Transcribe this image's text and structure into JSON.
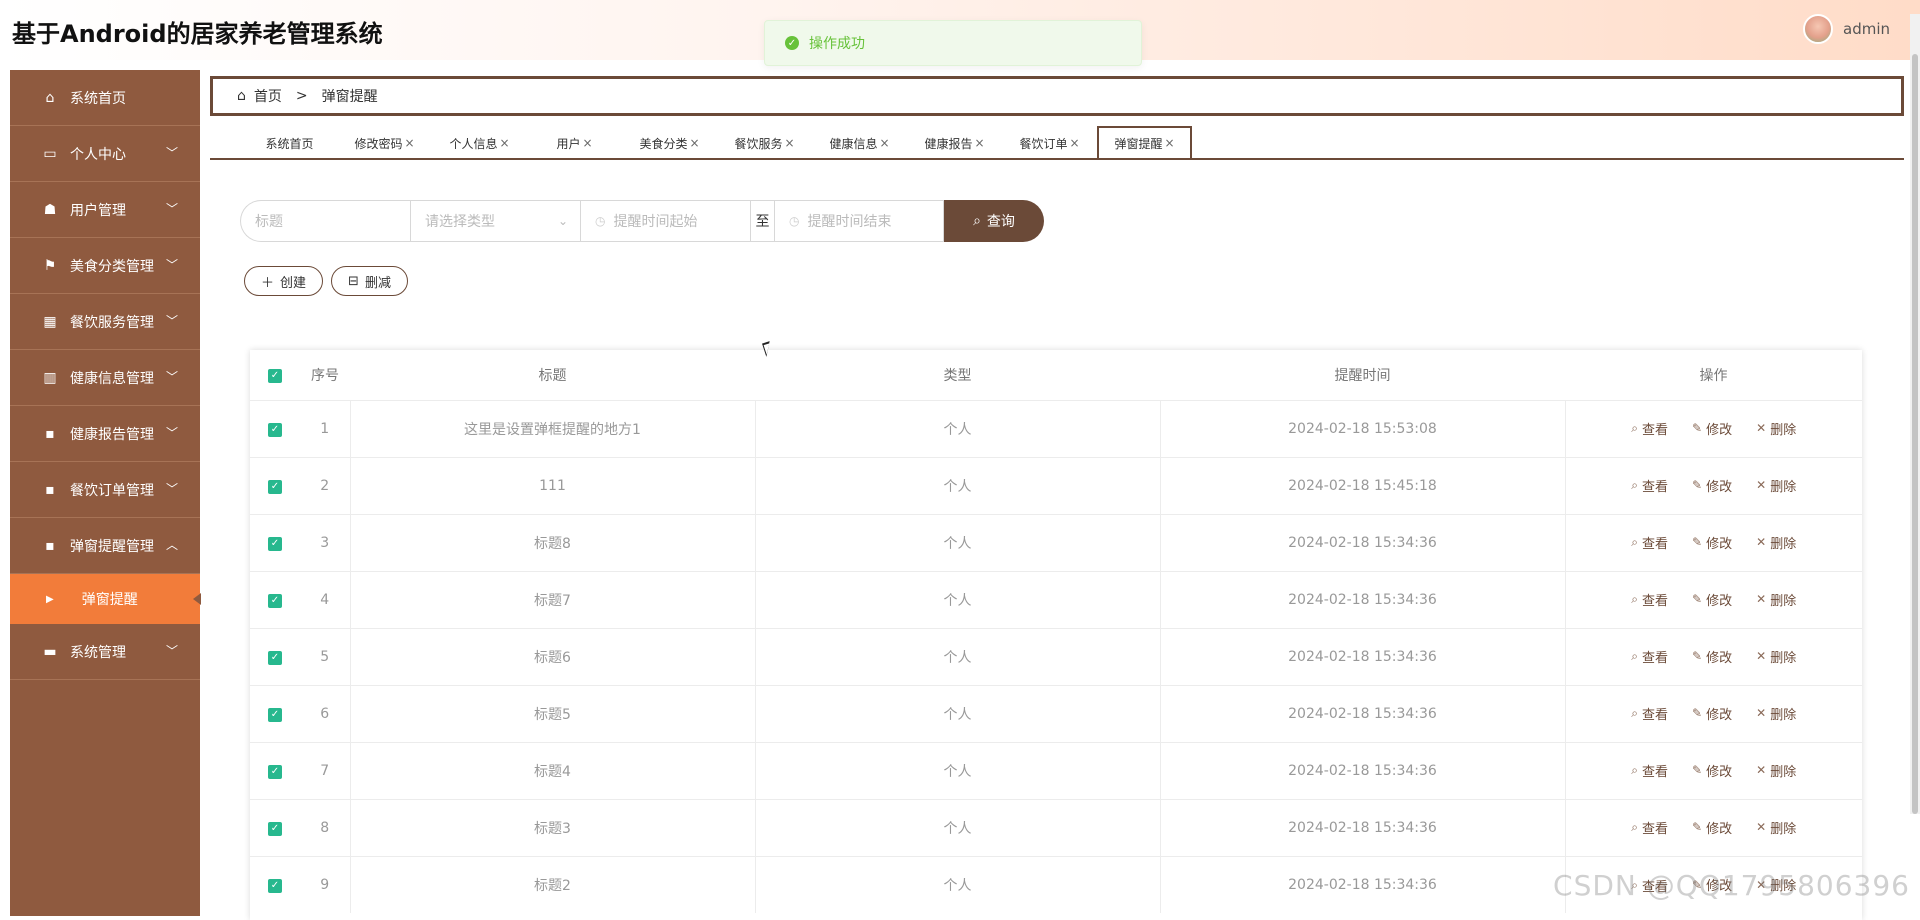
{
  "app": {
    "title": "基于Android的居家养老管理系统"
  },
  "user": {
    "name": "admin"
  },
  "toast": {
    "message": "操作成功"
  },
  "sidebar": {
    "items": [
      {
        "label": "系统首页",
        "icon": "home-icon",
        "glyph": "⌂",
        "expandable": false
      },
      {
        "label": "个人中心",
        "icon": "card-icon",
        "glyph": "▭",
        "expandable": true
      },
      {
        "label": "用户管理",
        "icon": "user-icon",
        "glyph": "☗",
        "expandable": true
      },
      {
        "label": "美食分类管理",
        "icon": "flag-icon",
        "glyph": "⚑",
        "expandable": true
      },
      {
        "label": "餐饮服务管理",
        "icon": "grid-icon",
        "glyph": "▦",
        "expandable": true
      },
      {
        "label": "健康信息管理",
        "icon": "book-icon",
        "glyph": "▥",
        "expandable": true
      },
      {
        "label": "健康报告管理",
        "icon": "apps-icon",
        "glyph": "▪",
        "expandable": true
      },
      {
        "label": "餐饮订单管理",
        "icon": "apps-icon",
        "glyph": "▪",
        "expandable": true
      },
      {
        "label": "弹窗提醒管理",
        "icon": "apps-icon",
        "glyph": "▪",
        "expandable": true,
        "open": true
      }
    ],
    "sub_item": {
      "label": "弹窗提醒"
    },
    "last_item": {
      "label": "系统管理",
      "icon": "monitor-icon",
      "glyph": "▬"
    }
  },
  "breadcrumb": {
    "home": "首页",
    "separator": ">",
    "current": "弹窗提醒"
  },
  "tabs": [
    {
      "label": "系统首页",
      "closable": false
    },
    {
      "label": "修改密码",
      "closable": true
    },
    {
      "label": "个人信息",
      "closable": true
    },
    {
      "label": "用户",
      "closable": true
    },
    {
      "label": "美食分类",
      "closable": true
    },
    {
      "label": "餐饮服务",
      "closable": true
    },
    {
      "label": "健康信息",
      "closable": true
    },
    {
      "label": "健康报告",
      "closable": true
    },
    {
      "label": "餐饮订单",
      "closable": true
    },
    {
      "label": "弹窗提醒",
      "closable": true,
      "active": true
    }
  ],
  "search": {
    "title_placeholder": "标题",
    "type_placeholder": "请选择类型",
    "start_placeholder": "提醒时间起始",
    "range_separator": "至",
    "end_placeholder": "提醒时间结束",
    "button_label": "查询"
  },
  "toolbar": {
    "create_label": "创建",
    "delete_label": "删减"
  },
  "table": {
    "headers": {
      "seq": "序号",
      "title": "标题",
      "type": "类型",
      "time": "提醒时间",
      "ops": "操作"
    },
    "op_labels": {
      "view": "查看",
      "edit": "修改",
      "delete": "删除"
    },
    "rows": [
      {
        "seq": "1",
        "title": "这里是设置弹框提醒的地方1",
        "type": "个人",
        "time": "2024-02-18 15:53:08"
      },
      {
        "seq": "2",
        "title": "111",
        "type": "个人",
        "time": "2024-02-18 15:45:18"
      },
      {
        "seq": "3",
        "title": "标题8",
        "type": "个人",
        "time": "2024-02-18 15:34:36"
      },
      {
        "seq": "4",
        "title": "标题7",
        "type": "个人",
        "time": "2024-02-18 15:34:36"
      },
      {
        "seq": "5",
        "title": "标题6",
        "type": "个人",
        "time": "2024-02-18 15:34:36"
      },
      {
        "seq": "6",
        "title": "标题5",
        "type": "个人",
        "time": "2024-02-18 15:34:36"
      },
      {
        "seq": "7",
        "title": "标题4",
        "type": "个人",
        "time": "2024-02-18 15:34:36"
      },
      {
        "seq": "8",
        "title": "标题3",
        "type": "个人",
        "time": "2024-02-18 15:34:36"
      },
      {
        "seq": "9",
        "title": "标题2",
        "type": "个人",
        "time": "2024-02-18 15:34:36"
      }
    ]
  },
  "watermark": "CSDN @QQ1795806396",
  "colors": {
    "sidebar": "#8f5a3f",
    "active": "#f27c3a",
    "accent": "#6b4a38",
    "checkbox": "#27b88e",
    "success": "#67c23a"
  }
}
